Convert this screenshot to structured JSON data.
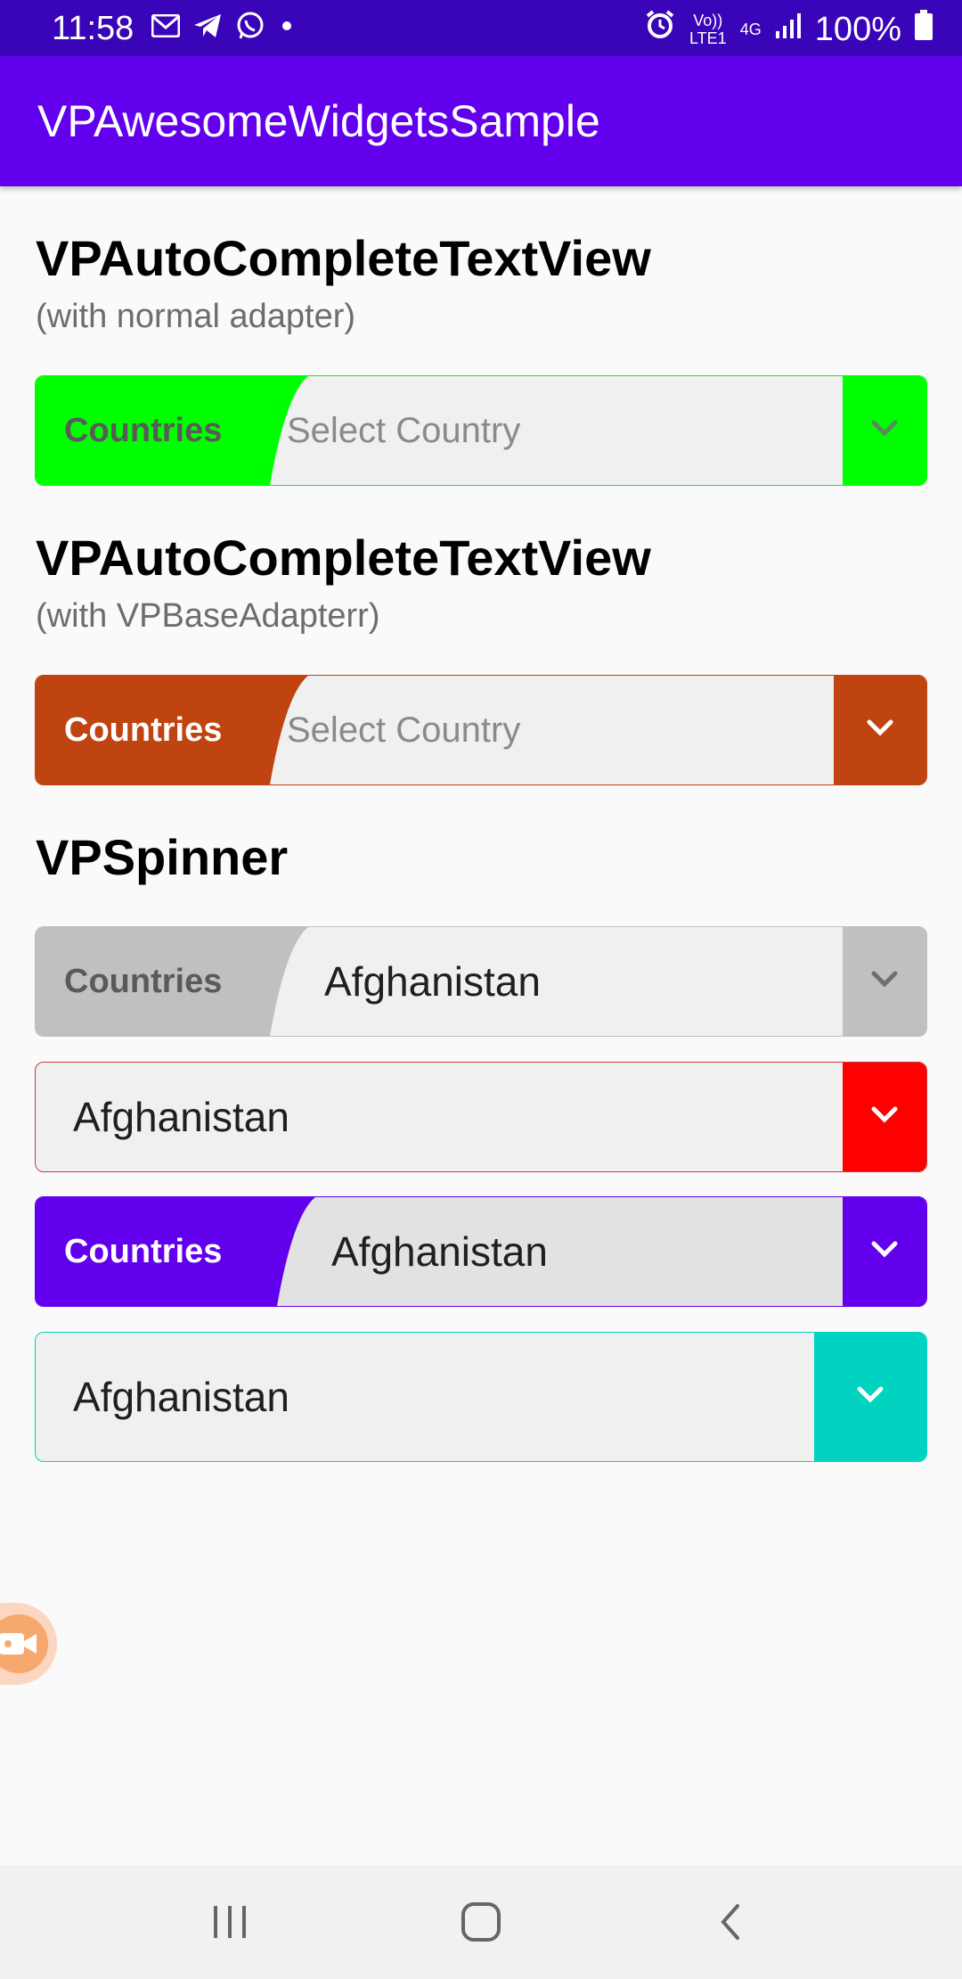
{
  "status_bar": {
    "time": "11:58",
    "notification_icons": [
      "gmail-icon",
      "telegram-icon",
      "whatsapp-icon",
      "dot-icon"
    ],
    "volte_label": "Vo)) LTE1",
    "network_label": "4G",
    "battery": "100%"
  },
  "app_bar": {
    "title": "VPAwesomeWidgetsSample"
  },
  "sections": [
    {
      "title": "VPAutoCompleteTextView",
      "subtitle": "(with normal adapter)"
    },
    {
      "title": "VPAutoCompleteTextView",
      "subtitle": "(with VPBaseAdapterr)"
    },
    {
      "title": "VPSpinner"
    }
  ],
  "autocomplete_normal": {
    "label": "Countries",
    "placeholder": "Select Country",
    "accent": "#00ff00",
    "label_color": "#5a5a5a"
  },
  "autocomplete_base": {
    "label": "Countries",
    "placeholder": "Select Country",
    "accent": "#c0440f",
    "label_color": "#ffffff"
  },
  "spinners": [
    {
      "label": "Countries",
      "value": "Afghanistan",
      "accent": "#c0c0c0",
      "label_color": "#5a5a5a"
    },
    {
      "value": "Afghanistan",
      "accent": "#ff0000"
    },
    {
      "label": "Countries",
      "value": "Afghanistan",
      "accent": "#6200ee",
      "label_color": "#ffffff"
    },
    {
      "value": "Afghanistan",
      "accent": "#00d4c0"
    }
  ],
  "colors": {
    "status_bar": "#3a04b8",
    "app_bar": "#6200ee",
    "background": "#fafafa"
  }
}
